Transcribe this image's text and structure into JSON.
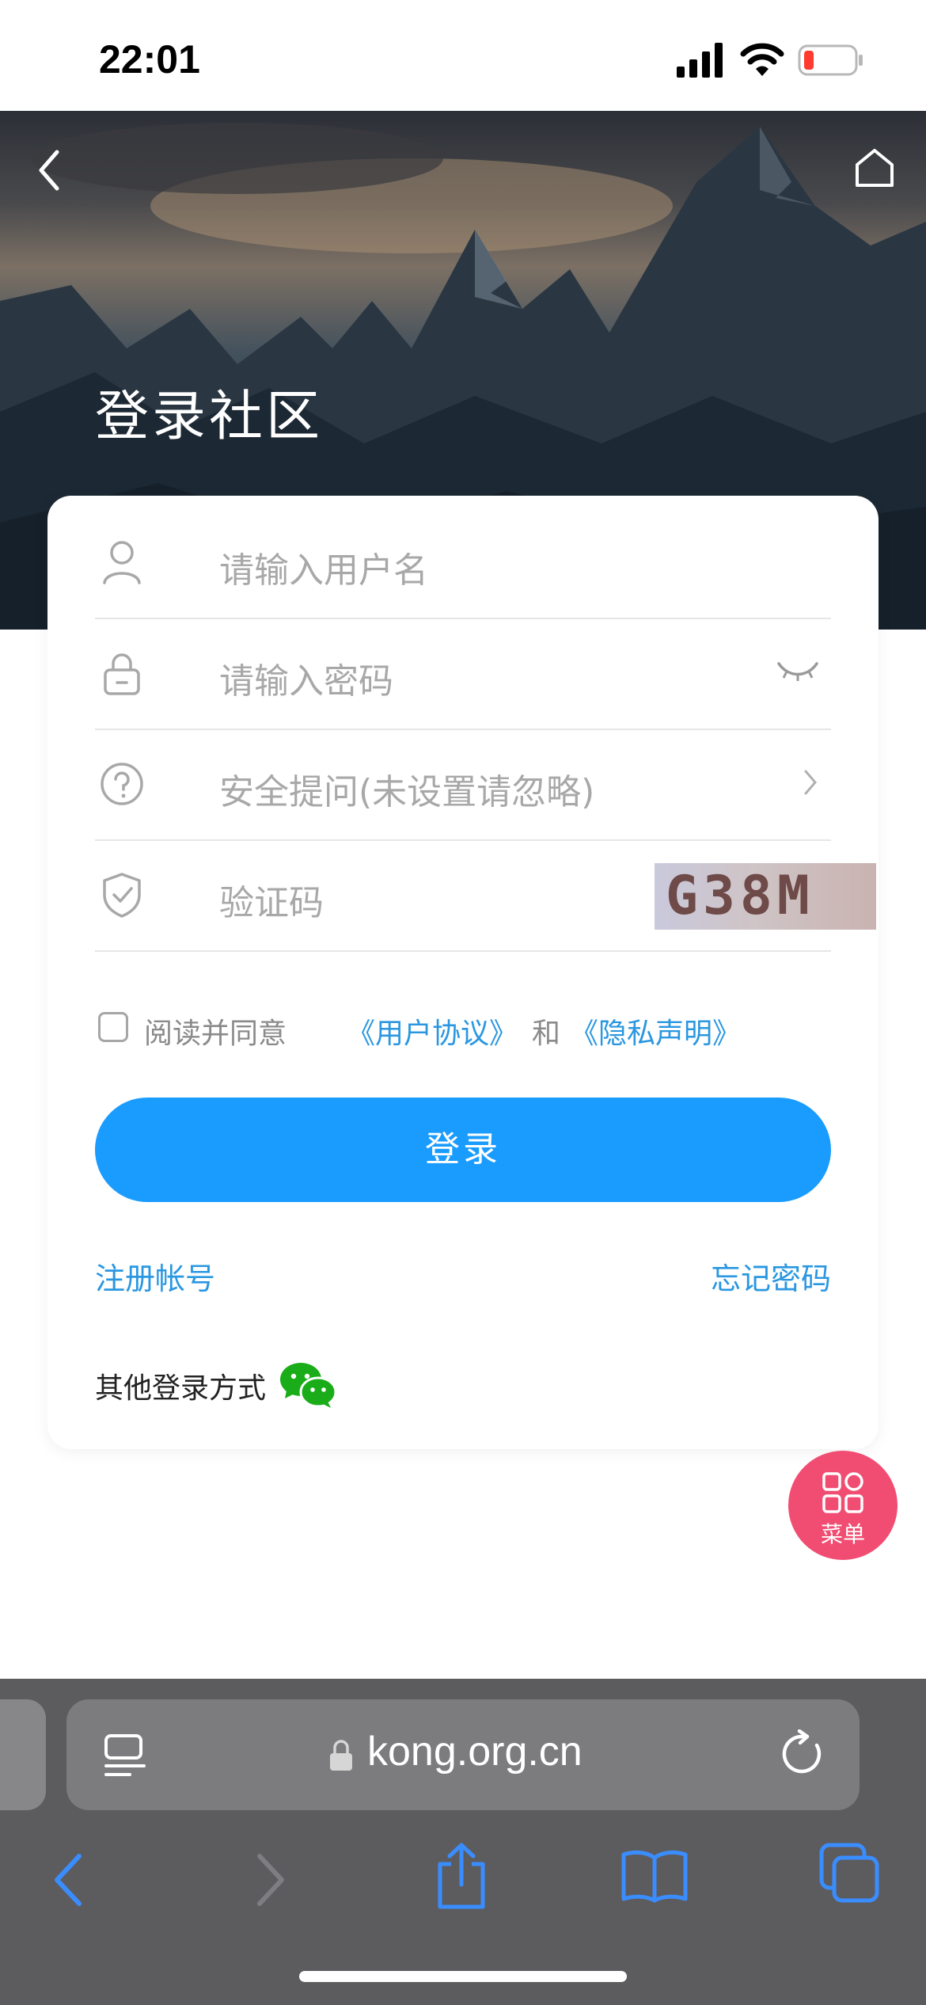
{
  "status_bar": {
    "time": "22:01"
  },
  "hero": {
    "title": "登录社区"
  },
  "form": {
    "username_placeholder": "请输入用户名",
    "password_placeholder": "请输入密码",
    "security_question": "安全提问(未设置请忽略)",
    "captcha_placeholder": "验证码",
    "captcha_text": "G38M",
    "agree_prefix": "阅读并同意",
    "user_agreement": "《用户协议》",
    "and_text": "和",
    "privacy_statement": "《隐私声明》",
    "login_label": "登录",
    "register_label": "注册帐号",
    "forgot_label": "忘记密码",
    "other_login_label": "其他登录方式"
  },
  "menu_fab": {
    "label": "菜单"
  },
  "browser": {
    "url": "kong.org.cn"
  },
  "colors": {
    "accent": "#1a9cff",
    "link": "#2a97e0",
    "fab": "#f14d72",
    "wechat": "#1aad19"
  }
}
